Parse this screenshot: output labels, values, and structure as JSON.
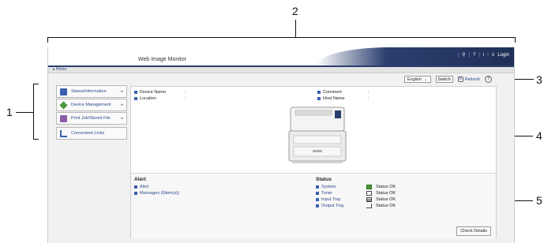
{
  "callouts": [
    "1",
    "2",
    "3",
    "4",
    "5"
  ],
  "app": {
    "title": "Web Image Monitor",
    "top_icons": [
      "search-icon",
      "help-icon",
      "info-icon",
      "list-icon"
    ],
    "login_label": "Login",
    "home_link": "Home"
  },
  "toolbar": {
    "language_value": "English",
    "switch_label": "Switch",
    "refresh_label": "Refresh"
  },
  "sidebar": {
    "items": [
      {
        "label": "Status/Information",
        "icon": "status-icon"
      },
      {
        "label": "Device Management",
        "icon": "device-icon"
      },
      {
        "label": "Print Job/Stored File",
        "icon": "print-icon"
      }
    ],
    "convenient_links": "Convenient Links"
  },
  "info": {
    "device_name_label": "Device Name",
    "location_label": "Location",
    "comment_label": "Comment",
    "host_name_label": "Host Name",
    "colon": ":"
  },
  "alert": {
    "title": "Alert",
    "links": [
      "Alert",
      "Messages (0item(s))"
    ]
  },
  "status": {
    "title": "Status",
    "rows": [
      {
        "label": "System",
        "value": "Status OK"
      },
      {
        "label": "Toner",
        "value": "Status OK"
      },
      {
        "label": "Input Tray",
        "value": "Status OK"
      },
      {
        "label": "Output Tray",
        "value": "Status OK"
      }
    ],
    "check_details": "Check Details"
  },
  "colors": {
    "accent": "#2b3f6e",
    "link": "#2b4a8b"
  }
}
